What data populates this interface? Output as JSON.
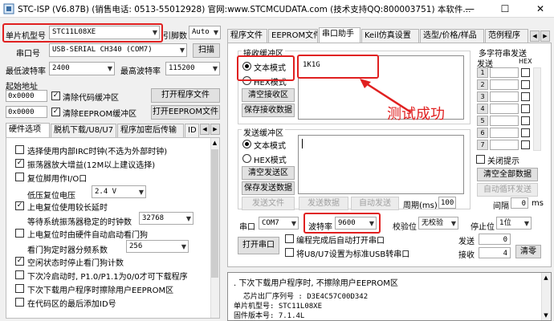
{
  "window": {
    "title": "STC-ISP (V6.87B) (销售电话: 0513-55012928) 官网:www.STCMCUDATA.com (技术支持QQ:800003751) 本软件...",
    "minimize": "—",
    "maximize": "☐",
    "close": "✕"
  },
  "left": {
    "mcu_label": "单片机型号",
    "mcu_value": "STC11L08XE",
    "pin_label": "引脚数",
    "pin_value": "Auto",
    "port_label": "串口号",
    "port_value": "USB-SERIAL CH340 (COM7)",
    "scan_button": "扫描",
    "min_baud_label": "最低波特率",
    "min_baud_value": "2400",
    "max_baud_label": "最高波特率",
    "max_baud_value": "115200",
    "start_addr_label": "起始地址",
    "addr1_value": "0x0000",
    "clear_code_label": "清除代码缓冲区",
    "open_prog_button": "打开程序文件",
    "addr2_value": "0x0000",
    "clear_eeprom_label": "清除EEPROM缓冲区",
    "open_eeprom_button": "打开EEPROM文件",
    "tabs": [
      "硬件选项",
      "脱机下载/U8/U7",
      "程序加密后传输",
      "ID"
    ],
    "options": [
      {
        "label": "选择使用内部IRC时钟(不选为外部时钟)",
        "checked": false
      },
      {
        "label": "振荡器放大增益(12M以上建议选择)",
        "checked": true
      },
      {
        "label": "复位脚用作I/O口",
        "checked": false
      }
    ],
    "reset_volt_label": "低压复位电压",
    "reset_volt_value": "2.4 V",
    "option_long_delay": {
      "label": "上电复位使用较长延时",
      "checked": true
    },
    "baud_wait_label": "等待系统振荡器稳定的时钟数",
    "baud_wait_value": "32768",
    "option_hw_watchdog": {
      "label": "上电复位时由硬件自动启动看门狗",
      "checked": false
    },
    "watchdog_div_label": "看门狗定时器分频系数",
    "watchdog_div_value": "256",
    "options2": [
      {
        "label": "空闲状态时停止看门狗计数",
        "checked": true
      },
      {
        "label": "下次冷启动时, P1.0/P1.1为0/0才可下载程序",
        "checked": false
      },
      {
        "label": "下次下载用户程序时擦除用户EEPROM区",
        "checked": false
      },
      {
        "label": "在代码区的最后添加ID号",
        "checked": false
      }
    ]
  },
  "right": {
    "tabs": [
      "程序文件",
      "EEPROM文件",
      "串口助手",
      "Keil仿真设置",
      "选型/价格/样品",
      "范例程序"
    ],
    "active_tab": 2,
    "recv_group": "接收缓冲区",
    "recv_text_mode": "文本模式",
    "recv_hex_mode": "HEX模式",
    "clear_recv_button": "清空接收区",
    "save_recv_button": "保存接收数据",
    "recv_content": "1K1G",
    "annotation": "测试成功",
    "multi_send_group": "多字符串发送",
    "send_col": "发送",
    "hex_col": "HEX",
    "multi_rows": [
      "1",
      "2",
      "3",
      "4",
      "5",
      "6",
      "7"
    ],
    "send_group": "发送缓冲区",
    "send_text_mode": "文本模式",
    "send_hex_mode": "HEX模式",
    "clear_send_button": "清空发送区",
    "save_send_button": "保存发送数据",
    "send_file_button": "发送文件",
    "send_data_button": "发送数据",
    "auto_send_button": "自动发送",
    "period_label": "周期(ms)",
    "period_value": "100",
    "close_tip_label": "关闭提示",
    "clear_all_button": "清空全部数据",
    "auto_loop_button": "自动循环发送",
    "interval_label": "间隔",
    "interval_value": "0",
    "interval_unit": "ms",
    "com_label": "串口",
    "com_value": "COM7",
    "baud_label": "波特率",
    "baud_value": "9600",
    "parity_label": "校验位",
    "parity_value": "无校验",
    "stop_label": "停止位",
    "stop_value": "1位",
    "open_port_button": "打开串口",
    "auto_open_label": "编程完成后自动打开串口",
    "usb_label": "将U8/U7设置为标准USB转串口",
    "send_count_label": "发送",
    "send_count_value": "0",
    "recv_count_label": "接收",
    "recv_count_value": "4",
    "clear_count_button": "清零"
  },
  "log": {
    "line1": ". 下次下载用户程序时, 不擦除用户EEPROM区",
    "line2": "芯片出厂序列号 : D3E4C57C00D342",
    "line3": "单片机型号: STC11L08XE",
    "line4": "固件版本号: 7.1.4L"
  },
  "colors": {
    "highlight_red": "#e02020"
  }
}
